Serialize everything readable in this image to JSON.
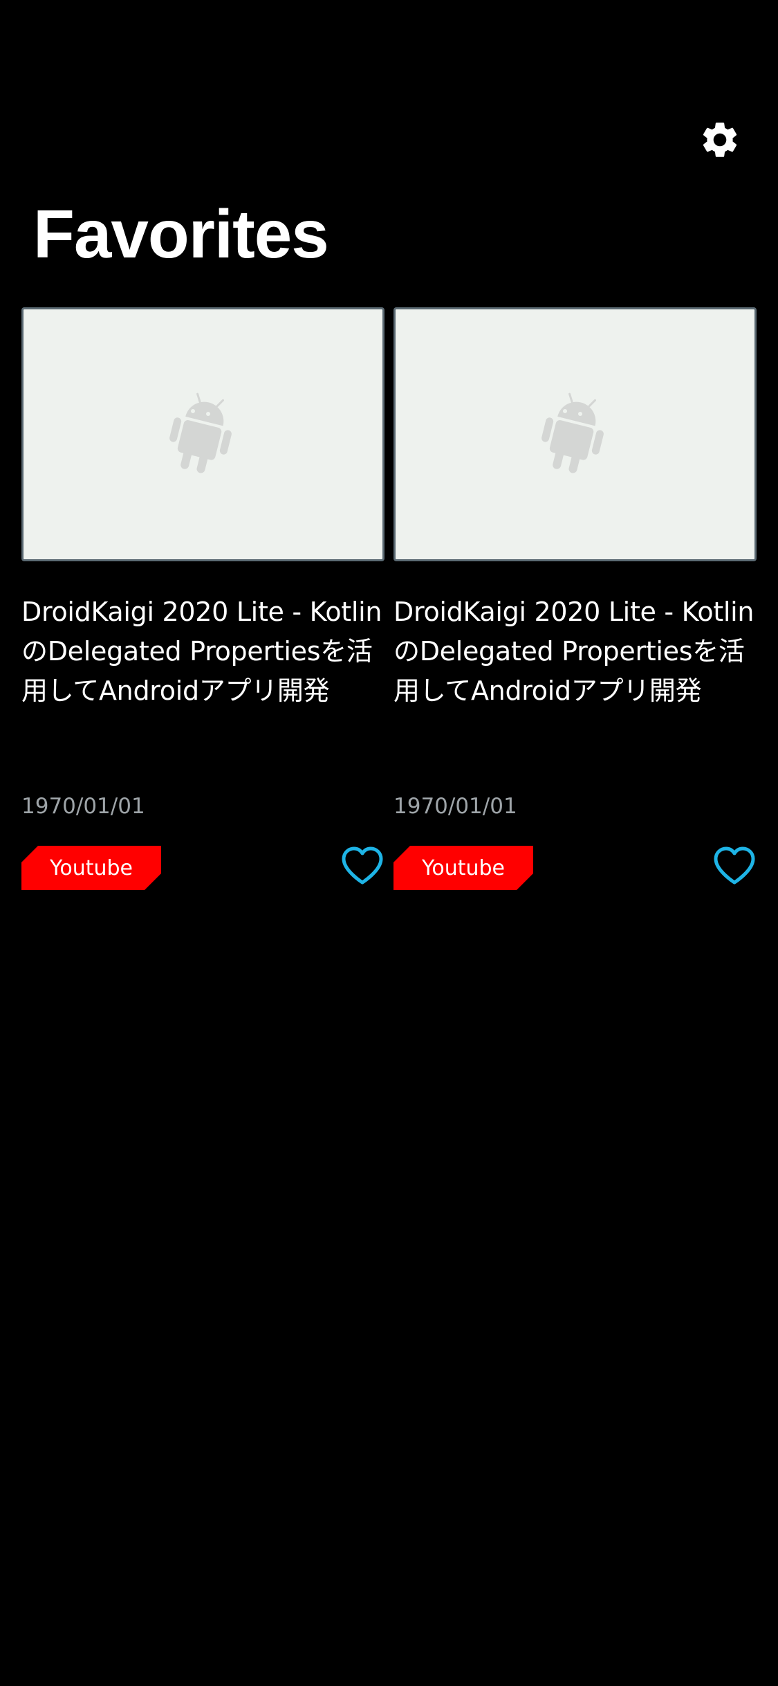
{
  "header": {
    "settings_icon": "gear-icon",
    "title": "Favorites"
  },
  "colors": {
    "background": "#000000",
    "tag": "#ff0000",
    "favorite": "#1eb4e6",
    "thumbnail_bg": "#eef2ee",
    "date_text": "#9ea4a8"
  },
  "cards": [
    {
      "thumbnail_icon": "android-placeholder-icon",
      "title": "DroidKaigi 2020 Lite - KotlinのDelegated Propertiesを活用してAndroidアプリ開発",
      "date": "1970/01/01",
      "tag": "Youtube",
      "favorite_icon": "heart-outline-icon"
    },
    {
      "thumbnail_icon": "android-placeholder-icon",
      "title": "DroidKaigi 2020 Lite - KotlinのDelegated Propertiesを活用してAndroidアプリ開発",
      "date": "1970/01/01",
      "tag": "Youtube",
      "favorite_icon": "heart-outline-icon"
    }
  ]
}
